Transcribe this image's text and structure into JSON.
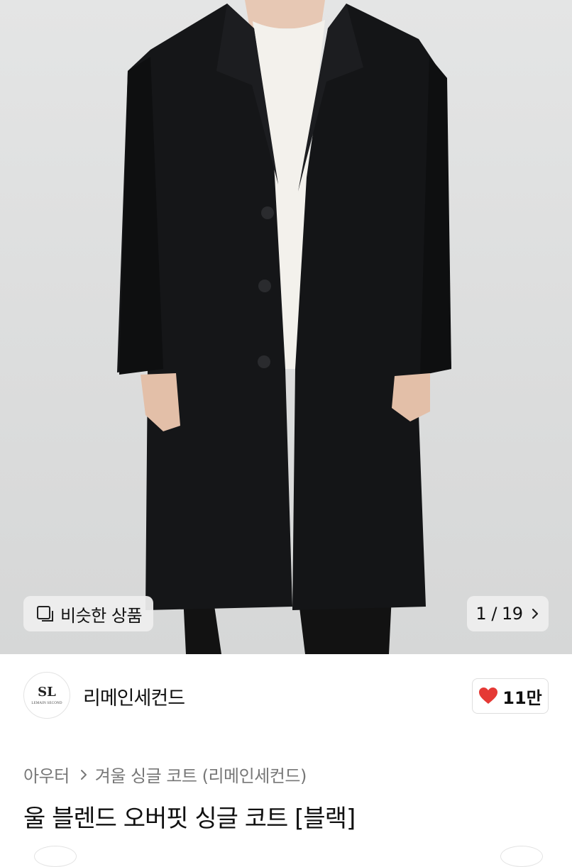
{
  "hero": {
    "similar_label": "비슷한 상품",
    "counter": "1 / 19"
  },
  "seller": {
    "logo_mark": "SL",
    "logo_sub": "LEMAIN SECOND",
    "name": "리메인세컨드"
  },
  "like": {
    "count": "11만",
    "color": "#e53935"
  },
  "breadcrumb": {
    "category": "아우터",
    "sub": "겨울 싱글 코트 (리메인세컨드)"
  },
  "product": {
    "title": "울 블렌드 오버핏 싱글 코트 [블랙]"
  }
}
